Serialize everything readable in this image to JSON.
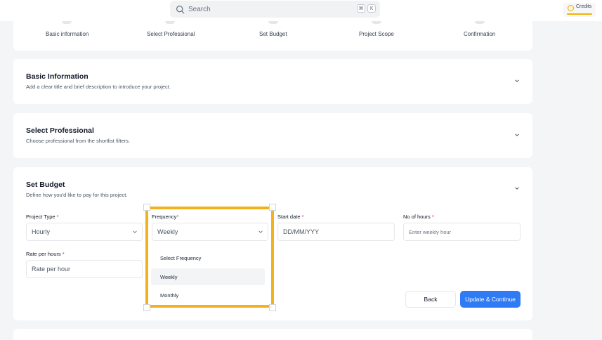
{
  "topbar": {
    "search_placeholder": "Search",
    "shortcut_keys": [
      "⌘",
      "K"
    ],
    "credits_label": "Credits"
  },
  "stepper": {
    "steps": [
      "Basic information",
      "Select Professional",
      "Set Budget",
      "Project Scope",
      "Confirmation"
    ]
  },
  "sections": {
    "basic": {
      "title": "Basic Information",
      "subtitle": "Add a clear title and brief description to introduce your project."
    },
    "professional": {
      "title": "Select Professional",
      "subtitle": "Choose professional from the shortlist filters."
    },
    "budget": {
      "title": "Set Budget",
      "subtitle": "Define how you'd like to pay for this project."
    }
  },
  "form": {
    "project_type": {
      "label": "Project Type",
      "required_mark": "*",
      "value": "Hourly"
    },
    "frequency": {
      "label": "Frequency",
      "required_mark": "*",
      "value": "Weekly"
    },
    "start_date": {
      "label": "Start date",
      "required_mark": "*",
      "placeholder": "DD/MM/YYY"
    },
    "hours": {
      "label": "No of hours",
      "required_mark": "*",
      "placeholder": "Enter weekly hour"
    },
    "rate": {
      "label": "Rate per hours",
      "required_mark": "*",
      "placeholder": "Rate per hour"
    }
  },
  "frequency_options": [
    "Select Frequency",
    "Weekly",
    "Monthly"
  ],
  "buttons": {
    "back": "Back",
    "next": "Update & Continue"
  },
  "colors": {
    "accent": "#2f7bf5",
    "highlight": "#f3b21c",
    "required": "#e11d48"
  }
}
